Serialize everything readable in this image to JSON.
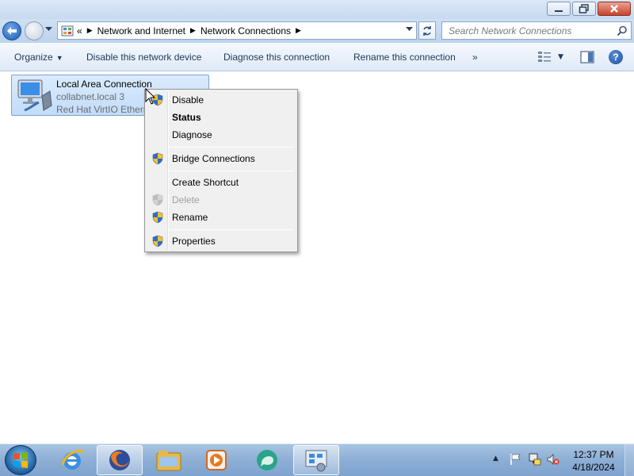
{
  "window": {
    "controls": [
      "minimize",
      "maximize",
      "close"
    ]
  },
  "address": {
    "prefix": "«",
    "crumbs": [
      "Network and Internet",
      "Network Connections"
    ],
    "search_placeholder": "Search Network Connections"
  },
  "commands": {
    "organize": "Organize",
    "disable": "Disable this network device",
    "diagnose": "Diagnose this connection",
    "rename": "Rename this connection",
    "more": "»"
  },
  "connection": {
    "name": "Local Area Connection",
    "network": "collabnet.local  3",
    "adapter": "Red Hat VirtIO Ethernet Adapter"
  },
  "context_menu": {
    "items": [
      {
        "label": "Disable",
        "shield": false,
        "bold": false,
        "disabled": false
      },
      {
        "label": "Status",
        "shield": false,
        "bold": true,
        "disabled": false
      },
      {
        "label": "Diagnose",
        "shield": false,
        "bold": false,
        "disabled": false
      },
      {
        "label": "Bridge Connections",
        "shield": true,
        "bold": false,
        "disabled": false
      },
      {
        "label": "Create Shortcut",
        "shield": false,
        "bold": false,
        "disabled": false
      },
      {
        "label": "Delete",
        "shield": true,
        "bold": false,
        "disabled": true
      },
      {
        "label": "Rename",
        "shield": true,
        "bold": false,
        "disabled": false
      },
      {
        "label": "Properties",
        "shield": true,
        "bold": false,
        "disabled": false
      }
    ]
  },
  "taskbar": {
    "apps": [
      "internet-explorer-icon",
      "firefox-icon",
      "windows-explorer-icon",
      "media-player-icon",
      "messenger-icon",
      "network-connections-icon"
    ],
    "time": "12:37 PM",
    "date": "4/18/2024"
  },
  "colors": {
    "accent": "#1e395b",
    "selection": "#c1dcfa",
    "taskbar": "#8fb0d6"
  }
}
